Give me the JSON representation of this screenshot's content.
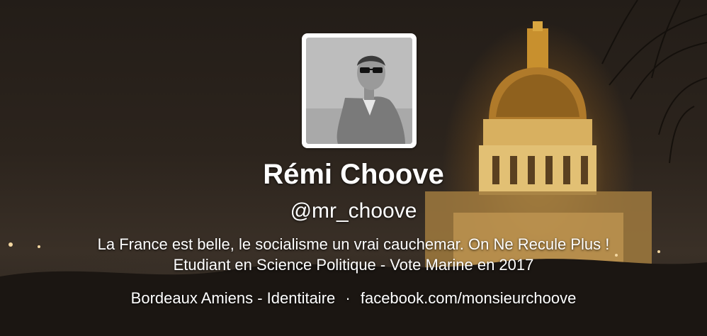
{
  "profile": {
    "name": "Rémi Choove",
    "handle": "@mr_choove",
    "bio_line1": "La France est belle, le socialisme un vrai cauchemar. On Ne Recule Plus !",
    "bio_line2": "Etudiant en Science Politique - Vote Marine en 2017",
    "location": "Bordeaux Amiens - Identitaire",
    "separator": "·",
    "website": "facebook.com/monsieurchoove"
  },
  "colors": {
    "text": "#ffffff",
    "avatar_frame": "#ffffff"
  }
}
